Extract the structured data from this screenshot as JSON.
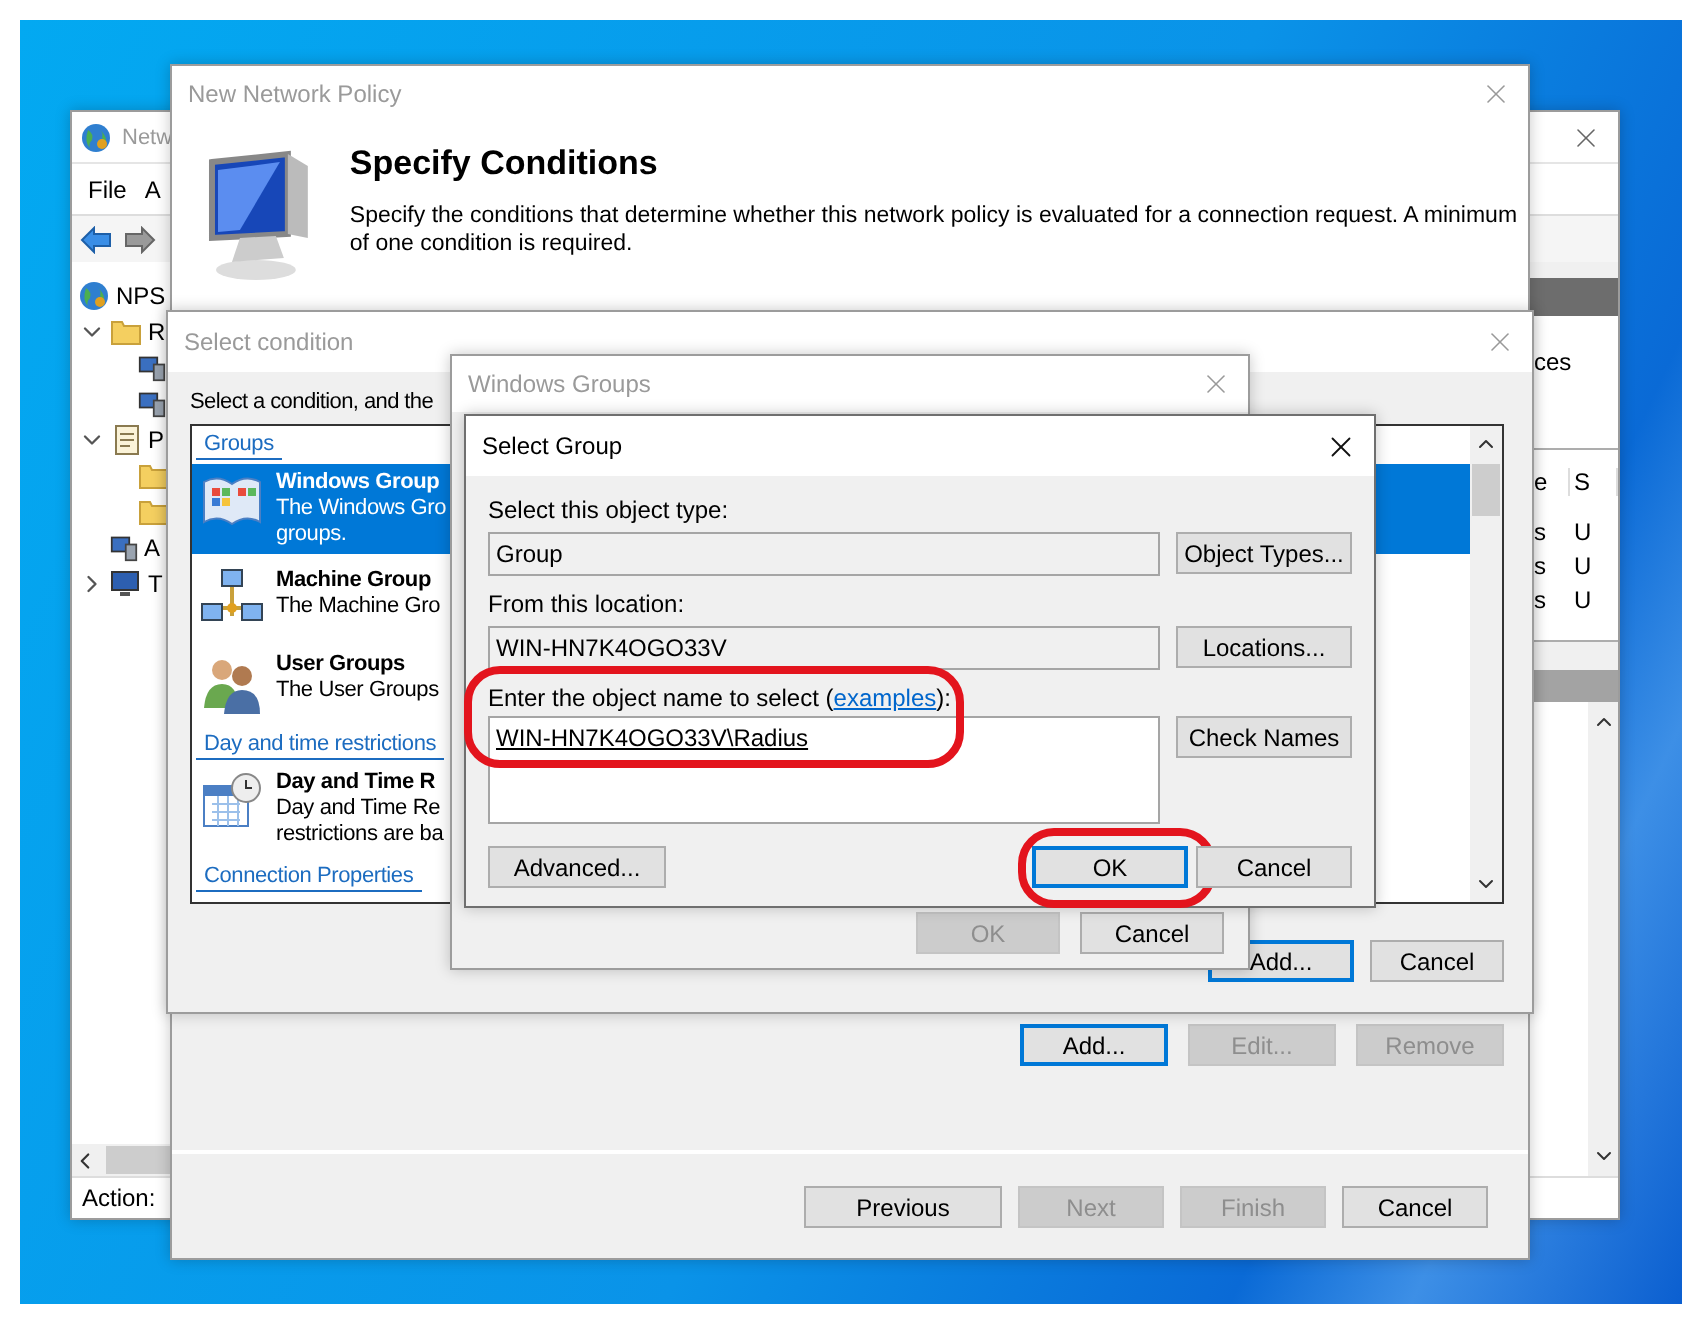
{
  "nps_window": {
    "title": "Netw",
    "menu": [
      "File",
      "A"
    ],
    "tree": [
      {
        "kind": "globe",
        "label": "NPS",
        "children": [
          {
            "kind": "folder",
            "label": "R",
            "expanded": true,
            "children": [
              {
                "kind": "server"
              },
              {
                "kind": "server"
              }
            ]
          },
          {
            "kind": "doc",
            "label": "P",
            "expanded": true,
            "children": [
              {
                "kind": "folder"
              },
              {
                "kind": "folder"
              }
            ]
          },
          {
            "kind": "server",
            "label": "A"
          },
          {
            "kind": "monitor",
            "label": "T",
            "expanded": false
          }
        ]
      }
    ],
    "right_pane": {
      "label": "ces",
      "table": {
        "columns": [
          "e",
          "S"
        ],
        "rows": [
          [
            "s",
            "U"
          ],
          [
            "s",
            "U"
          ],
          [
            "s",
            "U"
          ]
        ]
      }
    },
    "status_bar": "Action:"
  },
  "new_network_policy": {
    "title": "New Network Policy",
    "heading": "Specify Conditions",
    "description": "Specify the conditions that determine whether this network policy is evaluated for a connection request. A minimum of one condition is required.",
    "condition_buttons": [
      {
        "label": "Add...",
        "focused": true,
        "disabled": false
      },
      {
        "label": "Edit...",
        "focused": false,
        "disabled": true
      },
      {
        "label": "Remove",
        "focused": false,
        "disabled": true
      }
    ],
    "nav_buttons": [
      {
        "label": "Previous",
        "disabled": false
      },
      {
        "label": "Next",
        "disabled": true
      },
      {
        "label": "Finish",
        "disabled": true
      },
      {
        "label": "Cancel",
        "disabled": false
      }
    ]
  },
  "select_condition": {
    "title": "Select condition",
    "instruction": "Select a condition, and the",
    "conditions": [
      {
        "kind": "header",
        "label": "Groups"
      },
      {
        "kind": "item",
        "name": "Windows Group",
        "lines": [
          "The Windows Gro",
          "groups."
        ],
        "selected": true
      },
      {
        "kind": "item",
        "name": "Machine Group",
        "lines": [
          "The Machine Gro"
        ],
        "selected": false
      },
      {
        "kind": "item",
        "name": "User Groups",
        "lines": [
          "The User Groups"
        ],
        "selected": false
      },
      {
        "kind": "header",
        "label": "Day and time restrictions"
      },
      {
        "kind": "item",
        "name": "Day and Time R",
        "lines": [
          "Day and Time Re",
          "restrictions are ba"
        ],
        "selected": false
      },
      {
        "kind": "header",
        "label": "Connection Properties"
      }
    ],
    "buttons": [
      {
        "label": "Add...",
        "focused": true
      },
      {
        "label": "Cancel",
        "focused": false
      }
    ]
  },
  "windows_groups": {
    "title": "Windows Groups",
    "buttons": [
      {
        "label": "OK",
        "disabled": true
      },
      {
        "label": "Cancel",
        "disabled": false
      }
    ]
  },
  "select_group": {
    "title": "Select Group",
    "object_type": {
      "label": "Select this object type:",
      "value": "Group",
      "button": "Object Types..."
    },
    "location": {
      "label": "From this location:",
      "value": "WIN-HN7K4OGO33V",
      "button": "Locations..."
    },
    "object_name": {
      "label": "Enter the object name to select (",
      "link": "examples",
      "label_end": "):",
      "value": "WIN-HN7K4OGO33V\\Radius",
      "button": "Check Names",
      "highlighted": true
    },
    "buttons": [
      {
        "label": "Advanced...",
        "focused": false,
        "highlighted": false
      },
      {
        "label": "OK",
        "focused": true,
        "highlighted": true
      },
      {
        "label": "Cancel",
        "focused": false,
        "highlighted": false
      }
    ]
  }
}
